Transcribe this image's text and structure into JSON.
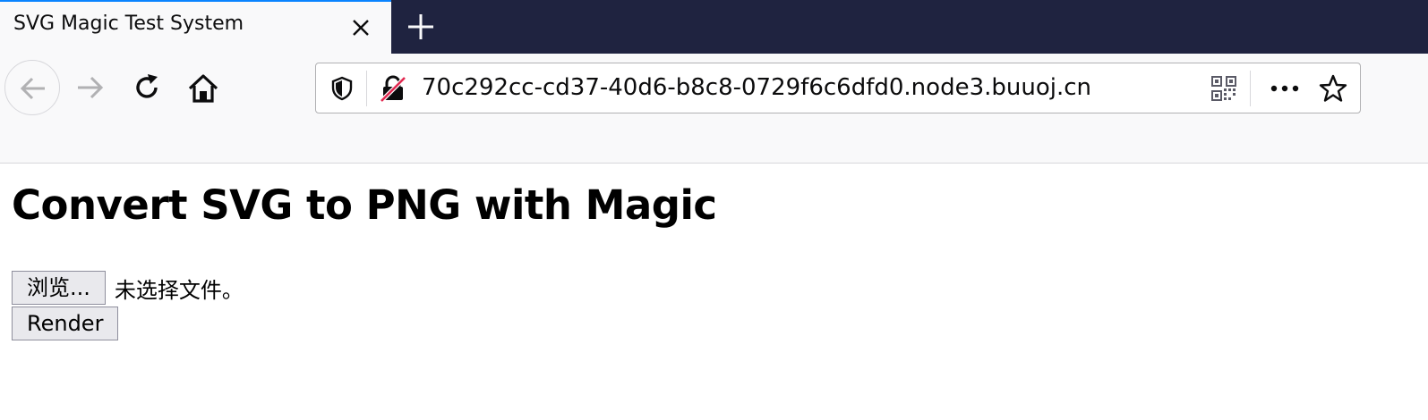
{
  "tab": {
    "title": "SVG Magic Test System"
  },
  "navbar": {
    "url": "70c292cc-cd37-40d6-b8c8-0729f6c6dfd0.node3.buuoj.cn"
  },
  "page": {
    "heading": "Convert SVG to PNG with Magic",
    "browse_label": "浏览...",
    "file_status": "未选择文件。",
    "render_label": "Render"
  },
  "colors": {
    "tabstrip_bg": "#1f2340",
    "tab_active_border": "#0a84ff",
    "toolbar_bg": "#f9f9fa",
    "insecure_lock_strike": "#e22850"
  },
  "icons": {
    "tab_close": "close-icon",
    "new_tab": "plus-icon",
    "back": "arrow-left-icon",
    "forward": "arrow-right-icon",
    "reload": "reload-icon",
    "home": "home-icon",
    "tracking": "shield-icon",
    "connection": "insecure-lock-icon",
    "qr": "qr-code-icon",
    "page_actions": "more-icon",
    "bookmark": "star-icon"
  }
}
